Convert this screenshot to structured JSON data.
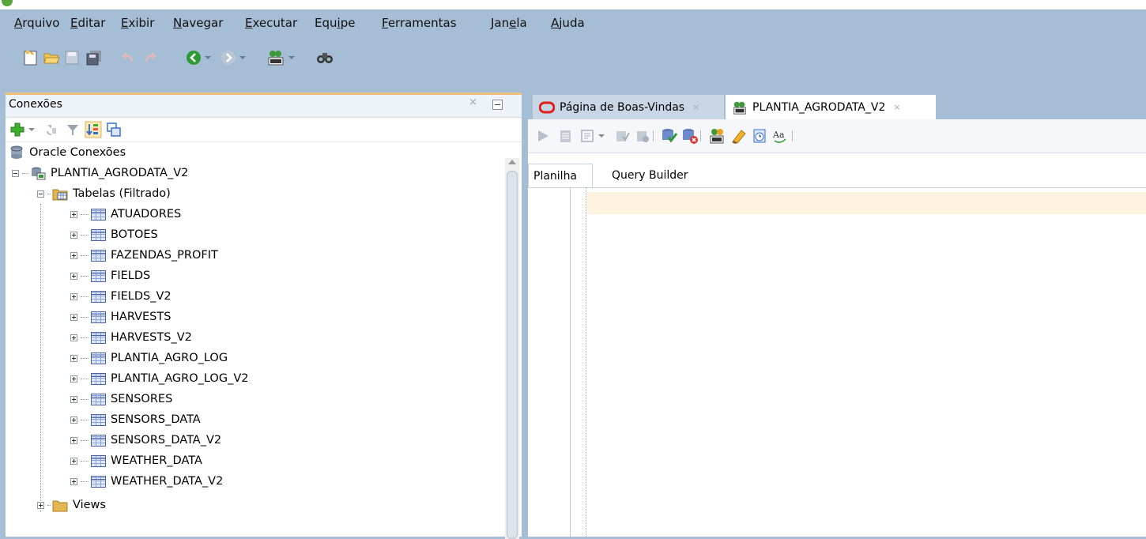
{
  "menu": {
    "items": [
      {
        "label": "Arquivo",
        "mnemonic": "A"
      },
      {
        "label": "Editar",
        "mnemonic": "E"
      },
      {
        "label": "Exibir",
        "mnemonic": "E"
      },
      {
        "label": "Navegar",
        "mnemonic": "N"
      },
      {
        "label": "Executar",
        "mnemonic": "E"
      },
      {
        "label": "Equipe",
        "mnemonic": "i"
      },
      {
        "label": "Ferramentas",
        "mnemonic": "F"
      },
      {
        "label": "Janela",
        "mnemonic": "l"
      },
      {
        "label": "Ajuda",
        "mnemonic": "A"
      }
    ]
  },
  "toolbar": {
    "icons": [
      "new-file-icon",
      "open-folder-icon",
      "save-icon",
      "save-all-icon",
      "undo-icon",
      "redo-icon",
      "back-icon",
      "forward-icon",
      "sql-worksheet-icon",
      "find-db-objects-icon"
    ]
  },
  "connections_panel": {
    "title": "Conexões",
    "close_glyph": "×",
    "tools": [
      "add-connection-icon",
      "refresh-icon",
      "filter-icon",
      "schema-browser-icon",
      "duplicate-icon"
    ],
    "root": "Oracle Conexões",
    "connection": "PLANTIA_AGRODATA_V2",
    "tables_node": "Tabelas (Filtrado)",
    "tables": [
      "ATUADORES",
      "BOTOES",
      "FAZENDAS_PROFIT",
      "FIELDS",
      "FIELDS_V2",
      "HARVESTS",
      "HARVESTS_V2",
      "PLANTIA_AGRO_LOG",
      "PLANTIA_AGRO_LOG_V2",
      "SENSORES",
      "SENSORS_DATA",
      "SENSORS_DATA_V2",
      "WEATHER_DATA",
      "WEATHER_DATA_V2"
    ],
    "views_node": "Views"
  },
  "editor": {
    "tabs": [
      {
        "label": "Página de Boas-Vindas",
        "active": false
      },
      {
        "label": "PLANTIA_AGRODATA_V2",
        "active": true
      }
    ],
    "tab_close_glyph": "×",
    "subtabs": [
      "Planilha",
      "Query Builder"
    ],
    "accent_current_line": "#fdf3de"
  },
  "colors": {
    "chrome": "#a6bdd6",
    "panel_border": "#f0c078",
    "oracle_red": "#e0201c"
  }
}
